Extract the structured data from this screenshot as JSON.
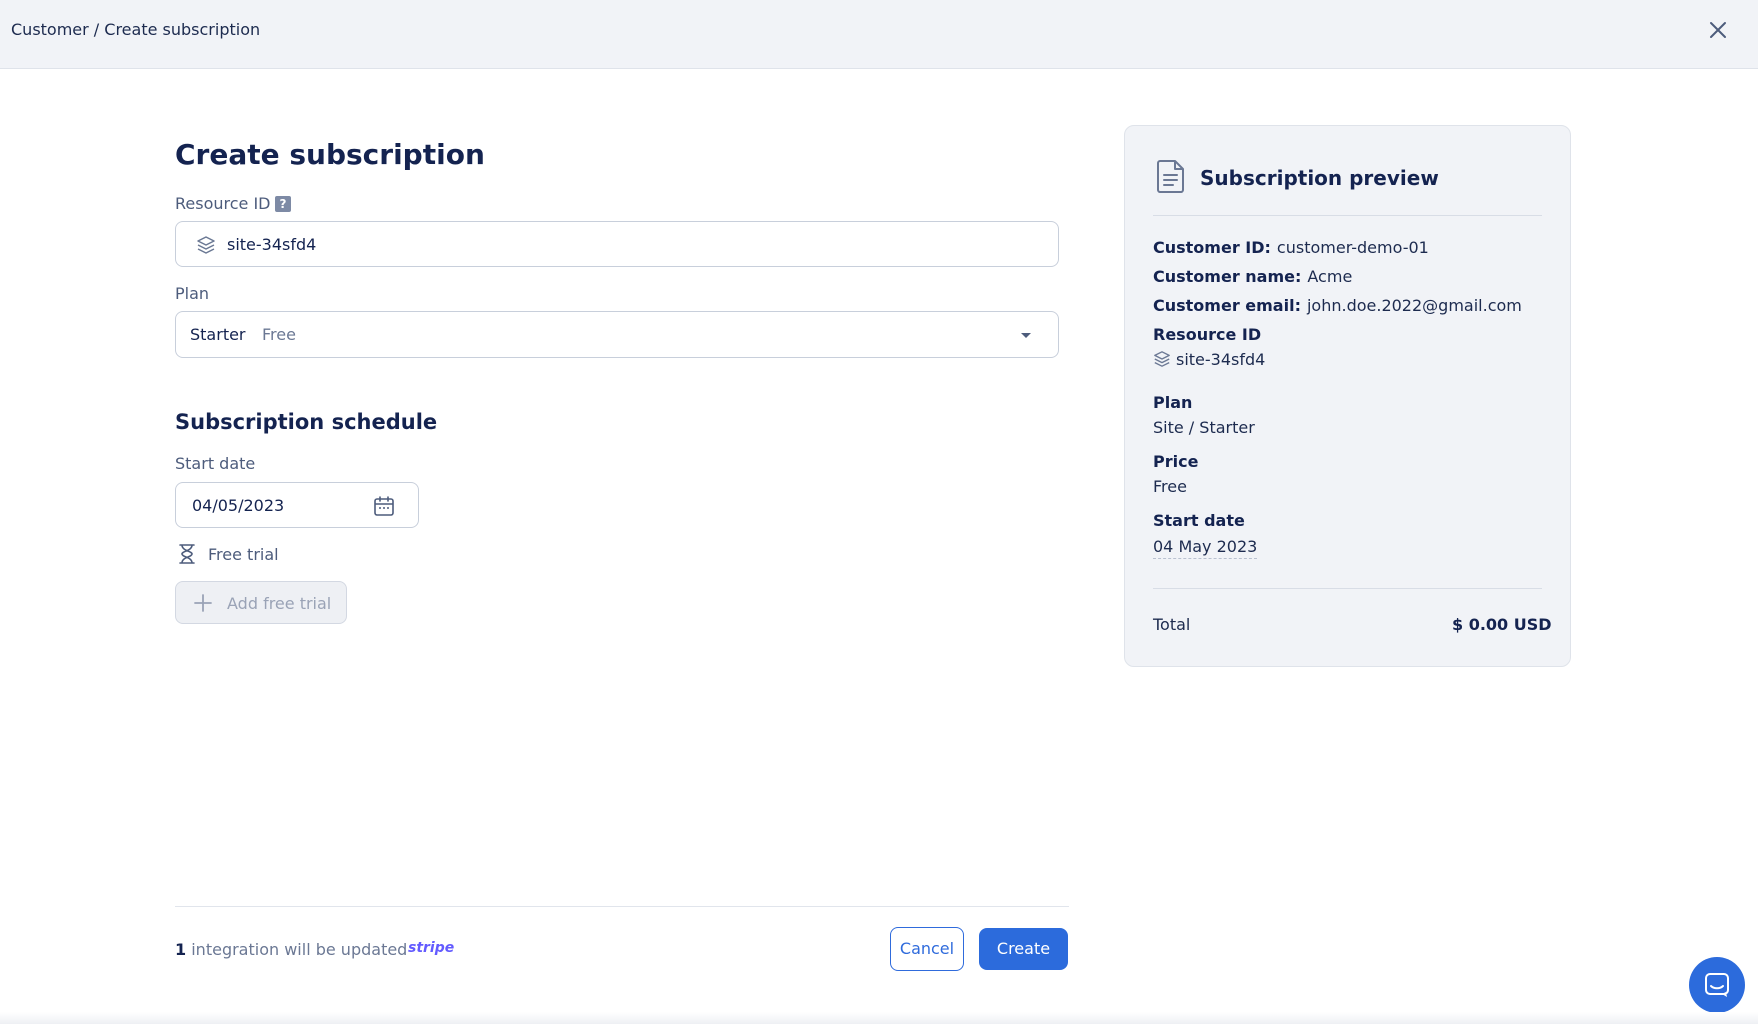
{
  "header": {
    "breadcrumb": "Customer / Create subscription"
  },
  "form": {
    "title": "Create subscription",
    "resource_id": {
      "label": "Resource ID",
      "help": "?",
      "value": "site-34sfd4"
    },
    "plan": {
      "label": "Plan",
      "value": "Starter",
      "price": "Free"
    },
    "schedule": {
      "title": "Subscription schedule",
      "start_date_label": "Start date",
      "start_date_value": "04/05/2023",
      "free_trial_label": "Free trial",
      "add_free_trial_label": "Add free trial"
    }
  },
  "footer": {
    "count": "1",
    "text": "integration will be updated",
    "integration": "stripe",
    "cancel_label": "Cancel",
    "create_label": "Create"
  },
  "preview": {
    "title": "Subscription preview",
    "customer_id_label": "Customer ID:",
    "customer_id": "customer-demo-01",
    "customer_name_label": "Customer name:",
    "customer_name": "Acme",
    "customer_email_label": "Customer email:",
    "customer_email": "john.doe.2022@gmail.com",
    "resource_id_label": "Resource ID",
    "resource_id": "site-34sfd4",
    "plan_label": "Plan",
    "plan": "Site / Starter",
    "price_label": "Price",
    "price": "Free",
    "start_date_label": "Start date",
    "start_date": "04 May 2023",
    "total_label": "Total",
    "total": "$ 0.00 USD"
  },
  "icons": {
    "close": "close-icon",
    "layers": "layers-icon",
    "chevron": "chevron-down-icon",
    "calendar": "calendar-icon",
    "hourglass": "hourglass-icon",
    "plus": "plus-icon",
    "document": "document-icon",
    "chat": "chat-icon"
  },
  "colors": {
    "primary": "#2c6bdc",
    "heading": "#142350",
    "muted": "#6b7894",
    "panel": "#f1f3f7",
    "stripe": "#635bff"
  }
}
